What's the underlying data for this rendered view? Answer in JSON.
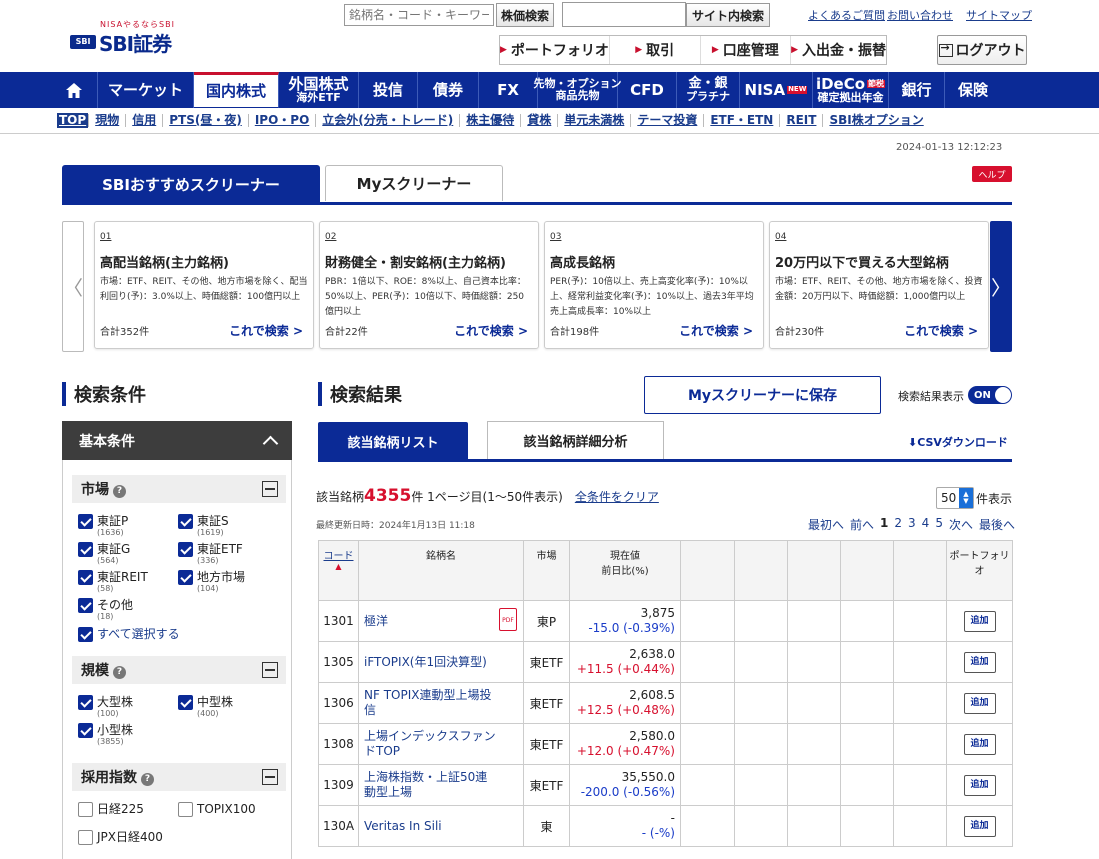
{
  "header": {
    "logo_tagline": "NISAやるならSBI",
    "logo_brand": "SBI証券",
    "logo_badge": "SBI",
    "stock_search_placeholder": "銘柄名・コード・キーワード",
    "price_search_label": "株価検索",
    "site_search_label": "サイト内検索",
    "links": [
      "よくあるご質問",
      "お問い合わせ",
      "サイトマップ"
    ],
    "quicknav": [
      "ポートフォリオ",
      "取引",
      "口座管理",
      "入出金・振替"
    ],
    "logout_label": "ログアウト"
  },
  "mainnav": [
    {
      "l1": "マーケット",
      "l2": ""
    },
    {
      "l1": "国内株式",
      "l2": ""
    },
    {
      "l1": "外国株式",
      "l2": "海外ETF"
    },
    {
      "l1": "投信",
      "l2": ""
    },
    {
      "l1": "債券",
      "l2": ""
    },
    {
      "l1": "FX",
      "l2": ""
    },
    {
      "l1": "先物・オプション",
      "l2": "商品先物"
    },
    {
      "l1": "CFD",
      "l2": ""
    },
    {
      "l1": "金・銀",
      "l2": "プラチナ"
    },
    {
      "l1": "NISA",
      "l2": ""
    },
    {
      "l1": "iDeCo",
      "l2": "確定拠出年金"
    },
    {
      "l1": "銀行",
      "l2": ""
    },
    {
      "l1": "保険",
      "l2": ""
    }
  ],
  "nisa_badge": "NEW",
  "ideco_badge": "節税",
  "subnav": [
    "TOP",
    "現物",
    "信用",
    "PTS(昼・夜)",
    "IPO・PO",
    "立会外(分売・トレード)",
    "株主優待",
    "貸株",
    "単元未満株",
    "テーマ投資",
    "ETF・ETN",
    "REIT",
    "SBI株オプション"
  ],
  "timestamp": "2024-01-13 12:12:23",
  "screener_tabs": [
    "SBIおすすめスクリーナー",
    "Myスクリーナー"
  ],
  "help_label": "ヘルプ",
  "cards": [
    {
      "num": "01",
      "title": "高配当銘柄(主力銘柄)",
      "desc": "市場：ETF、REIT、その他、地方市場を除く、配当利回り(予)：3.0%以上、時価総額：100億円以上",
      "count": "合計352件",
      "go": "これで検索 >"
    },
    {
      "num": "02",
      "title": "財務健全・割安銘柄(主力銘柄)",
      "desc": "PBR：1倍以下、ROE：8%以上、自己資本比率：50%以上、PER(予)：10倍以下、時価総額：250億円以上",
      "count": "合計22件",
      "go": "これで検索 >"
    },
    {
      "num": "03",
      "title": "高成長銘柄",
      "desc": "PER(予)：10倍以上、売上高変化率(予)：10%以上、経常利益変化率(予)：10%以上、過去3年平均売上高成長率：10%以上",
      "count": "合計198件",
      "go": "これで検索 >"
    },
    {
      "num": "04",
      "title": "20万円以下で買える大型銘柄",
      "desc": "市場：ETF、REIT、その他、地方市場を除く、投資金額：20万円以下、時価総額：1,000億円以上",
      "count": "合計230件",
      "go": "これで検索 >"
    }
  ],
  "conditions": {
    "title": "検索条件",
    "basic": "基本条件",
    "market": {
      "title": "市場",
      "items": [
        {
          "label": "東証P",
          "count": "(1636)"
        },
        {
          "label": "東証S",
          "count": "(1619)"
        },
        {
          "label": "東証G",
          "count": "(564)"
        },
        {
          "label": "東証ETF",
          "count": "(336)"
        },
        {
          "label": "東証REIT",
          "count": "(58)"
        },
        {
          "label": "地方市場",
          "count": "(104)"
        },
        {
          "label": "その他",
          "count": "(18)"
        }
      ],
      "select_all": "すべて選択する"
    },
    "scale": {
      "title": "規模",
      "items": [
        {
          "label": "大型株",
          "count": "(100)"
        },
        {
          "label": "中型株",
          "count": "(400)"
        },
        {
          "label": "小型株",
          "count": "(3855)"
        }
      ]
    },
    "index": {
      "title": "採用指数",
      "items": [
        {
          "label": "日経225"
        },
        {
          "label": "TOPIX100"
        },
        {
          "label": "JPX日経400"
        }
      ]
    }
  },
  "results": {
    "title": "検索結果",
    "save_label": "Myスクリーナーに保存",
    "display_label": "検索結果表示",
    "toggle_label": "ON",
    "tabs": [
      "該当銘柄リスト",
      "該当銘柄詳細分析"
    ],
    "csv_label": "CSVダウンロード",
    "count_prefix": "該当銘柄",
    "count": "4355",
    "count_suffix": "件 1ページ目(1〜50件表示)",
    "clear_label": "全条件をクリア",
    "per_page": "50",
    "per_page_suffix": "件表示",
    "updated": "最終更新日時：2024年1月13日 11:18",
    "pager": [
      "最初へ",
      "前へ",
      "1",
      "2",
      "3",
      "4",
      "5",
      "次へ",
      "最後へ"
    ],
    "columns": {
      "code": "コード",
      "name": "銘柄名",
      "market": "市場",
      "price1": "現在値",
      "price2": "前日比(%)",
      "portfolio": "ポートフォリオ"
    },
    "add_label": "追加",
    "pdf_label": "PDF",
    "rows": [
      {
        "code": "1301",
        "name": "極洋",
        "market": "東P",
        "price": "3,875",
        "change": "-15.0 (-0.39%)",
        "dir": "dn"
      },
      {
        "code": "1305",
        "name": "iFTOPIX(年1回決算型)",
        "market": "東ETF",
        "price": "2,638.0",
        "change": "+11.5 (+0.44%)",
        "dir": "up"
      },
      {
        "code": "1306",
        "name": "NF TOPIX連動型上場投信",
        "market": "東ETF",
        "price": "2,608.5",
        "change": "+12.5 (+0.48%)",
        "dir": "up"
      },
      {
        "code": "1308",
        "name": "上場インデックスファンドTOP",
        "market": "東ETF",
        "price": "2,580.0",
        "change": "+12.0 (+0.47%)",
        "dir": "up"
      },
      {
        "code": "1309",
        "name": "上海株指数・上証50連動型上場",
        "market": "東ETF",
        "price": "35,550.0",
        "change": "-200.0 (-0.56%)",
        "dir": "dn"
      },
      {
        "code": "130A",
        "name": "Veritas In Sili",
        "market": "東",
        "price": "-",
        "change": "- (-%)",
        "dir": "dn"
      }
    ]
  }
}
